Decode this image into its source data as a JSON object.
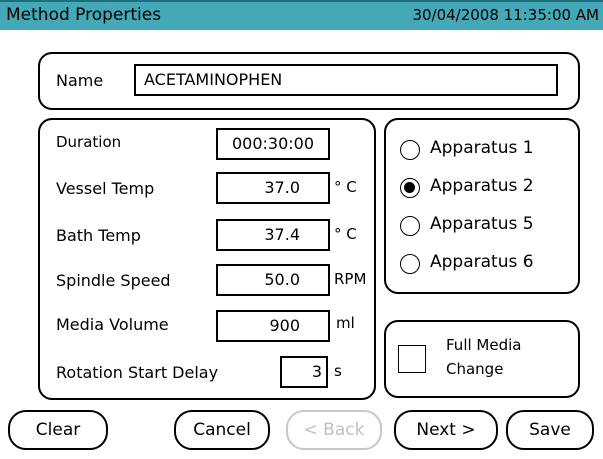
{
  "header": {
    "title": "Method Properties",
    "datetime": "30/04/2008 11:35:00 AM"
  },
  "name_panel": {
    "label": "Name",
    "value": "ACETAMINOPHEN"
  },
  "params": {
    "duration": {
      "label": "Duration",
      "value": "000:30:00"
    },
    "vessel_temp": {
      "label": "Vessel Temp",
      "value": "37.0",
      "unit": "° C"
    },
    "bath_temp": {
      "label": "Bath Temp",
      "value": "37.4",
      "unit": "° C"
    },
    "spindle_speed": {
      "label": "Spindle Speed",
      "value": "50.0",
      "unit": "RPM"
    },
    "media_volume": {
      "label": "Media Volume",
      "value": "900",
      "unit": "ml"
    },
    "rotation_delay": {
      "label": "Rotation Start Delay",
      "value": "3",
      "unit": "s"
    }
  },
  "apparatus": {
    "selected": "Apparatus 2",
    "options": [
      "Apparatus 1",
      "Apparatus 2",
      "Apparatus 5",
      "Apparatus 6"
    ]
  },
  "media_change": {
    "line1": "Full Media",
    "line2": "Change",
    "checked": false
  },
  "buttons": {
    "clear": "Clear",
    "cancel": "Cancel",
    "back": "< Back",
    "next": "Next >",
    "save": "Save"
  },
  "colors": {
    "titlebar": "#44a8b6",
    "disabled": "#c0c0c0"
  }
}
